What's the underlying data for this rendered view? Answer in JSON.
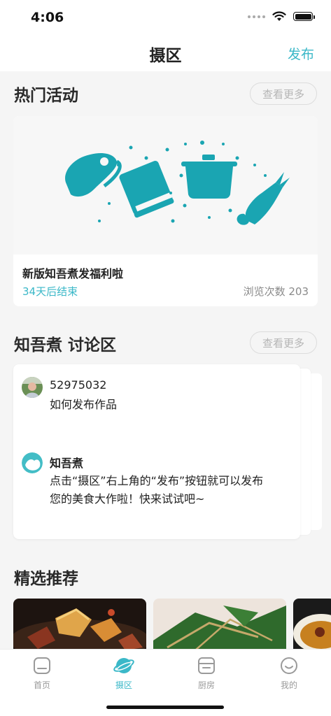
{
  "status_bar": {
    "time": "4:06"
  },
  "navbar": {
    "title": "摄区",
    "action_label": "发布"
  },
  "hot_activities": {
    "title": "热门活动",
    "more_label": "查看更多",
    "card": {
      "title": "新版知吾煮发福利啦",
      "deadline": "34天后结束",
      "views": "浏览次数 203"
    }
  },
  "discussion": {
    "title": "知吾煮 讨论区",
    "more_label": "查看更多",
    "posts": [
      {
        "user": "52975032",
        "text": "如何发布作品"
      },
      {
        "user": "知吾煮",
        "text_line1": "点击“摄区”右上角的“发布”按钮就可以发布",
        "text_line2": "您的美食大作啦！快来试试吧~"
      }
    ]
  },
  "recommend": {
    "title": "精选推荐"
  },
  "tabbar": {
    "items": [
      {
        "label": "首页",
        "icon": "home-icon"
      },
      {
        "label": "摄区",
        "icon": "planet-icon"
      },
      {
        "label": "厨房",
        "icon": "kitchen-icon"
      },
      {
        "label": "我的",
        "icon": "smile-icon"
      }
    ]
  },
  "colors": {
    "accent": "#3bb8c8",
    "background": "#f5f5f5"
  }
}
